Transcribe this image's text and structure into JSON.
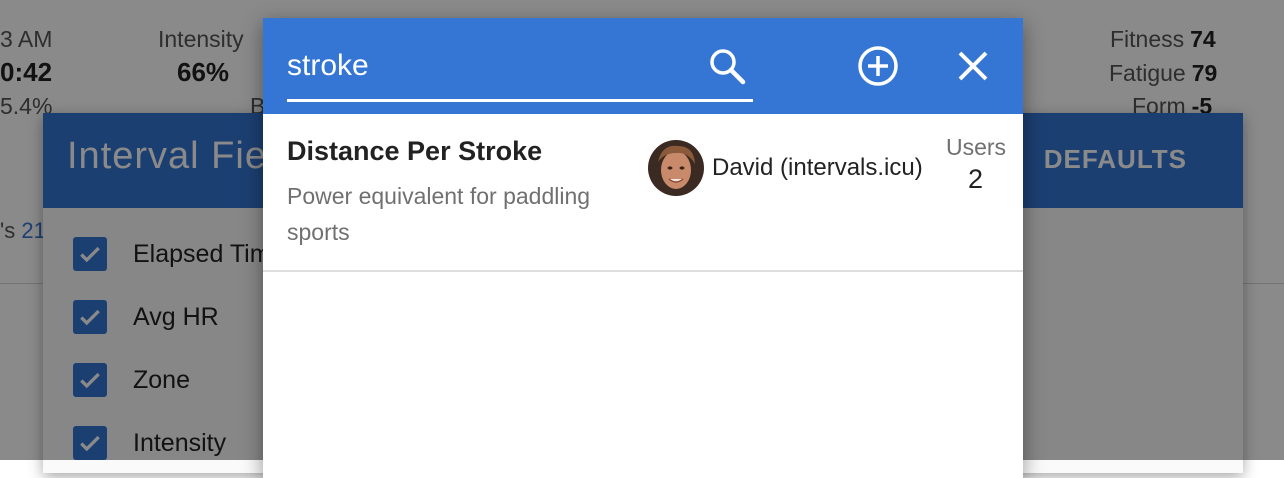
{
  "background": {
    "stats": {
      "time_fragment": "3 AM",
      "duration_fragment": "0:42",
      "percent_fragment": "5.4%",
      "intensity_label": "Intensity",
      "intensity_value": "66%",
      "b_fragment": "B",
      "fitness_label": "Fitness",
      "fitness_value": "74",
      "fatigue_label": "Fatigue",
      "fatigue_value": "79",
      "form_label": "Form",
      "form_value": "-5",
      "side_fragment_a": "'s",
      "side_fragment_b": "21"
    },
    "fields_dialog": {
      "title": "Interval Fie",
      "defaults_label": "DEFAULTS",
      "fields": [
        {
          "label": "Elapsed Tim",
          "checked": true
        },
        {
          "label": "Avg HR",
          "checked": true
        },
        {
          "label": "Zone",
          "checked": true
        },
        {
          "label": "Intensity",
          "checked": true
        }
      ]
    }
  },
  "search_dialog": {
    "query": "stroke",
    "icons": {
      "search": "search-icon",
      "add": "add-circle-icon",
      "close": "close-icon"
    },
    "results": [
      {
        "name": "Distance Per Stroke",
        "description": "Power equivalent for paddling sports",
        "author": "David (intervals.icu)",
        "users_label": "Users",
        "users_count": "2"
      }
    ]
  },
  "colors": {
    "accent": "#3575d3",
    "scrim": "rgba(0,0,0,0.46)"
  }
}
